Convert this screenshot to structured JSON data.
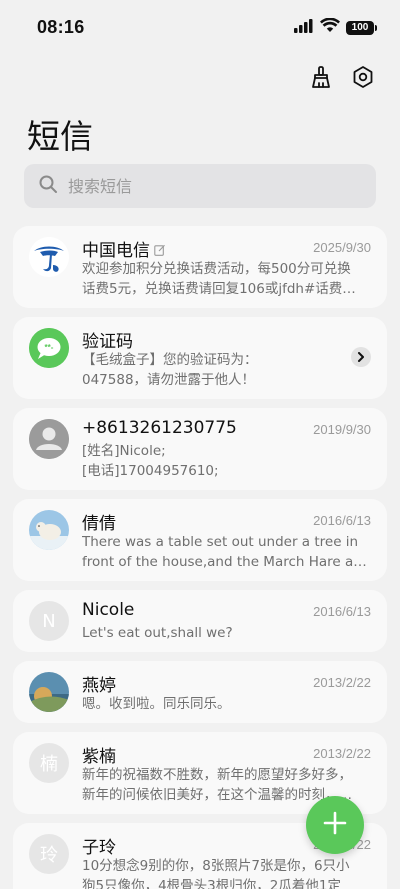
{
  "status": {
    "time": "08:16",
    "battery": "100"
  },
  "title": "短信",
  "search": {
    "placeholder": "搜索短信"
  },
  "colors": {
    "accent": "#5ac85a",
    "telecom_blue": "#1f5cae"
  },
  "conversations": [
    {
      "name": "中国电信",
      "date": "2025/9/30",
      "line1": "欢迎参加积分兑换话费活动，每500分可兑换",
      "line2": "话费5元，兑换话费请回复106或jfdh#话费…",
      "avatar": "china-telecom-logo-icon"
    },
    {
      "name": "验证码",
      "date": "",
      "line1": "【毛绒盒子】您的验证码为：",
      "line2": "047588，请勿泄露于他人！",
      "avatar": "message-bubble-icon"
    },
    {
      "name": "+8613261230775",
      "date": "2019/9/30",
      "line1": "[姓名]Nicole;",
      "line2": "[电话]17004957610;",
      "avatar": "person-icon"
    },
    {
      "name": "倩倩",
      "date": "2016/6/13",
      "line1": "There was a table set out under a tree in",
      "line2": "front of the house,and the March Hare an…",
      "avatar": "polar-bear-photo"
    },
    {
      "name": "Nicole",
      "date": "2016/6/13",
      "line1": "Let's eat out,shall we?",
      "line2": "",
      "avatar_letter": "N"
    },
    {
      "name": "燕婷",
      "date": "2013/2/22",
      "line1": "嗯。收到啦。同乐同乐。",
      "line2": "",
      "avatar": "landscape-photo"
    },
    {
      "name": "紫楠",
      "date": "2013/2/22",
      "line1": "新年的祝福数不胜数，新年的愿望好多好多，",
      "line2": "新年的问候依旧美好，在这个温馨的时刻，…",
      "avatar_letter": "楠"
    },
    {
      "name": "子玲",
      "date": "2013/2/22",
      "line1": "10分想念9别的你，8张照片7张是你，6只小",
      "line2": "狗5只像你，4根骨头3根归你，2瓜着他1定",
      "avatar_letter": "玲"
    }
  ]
}
